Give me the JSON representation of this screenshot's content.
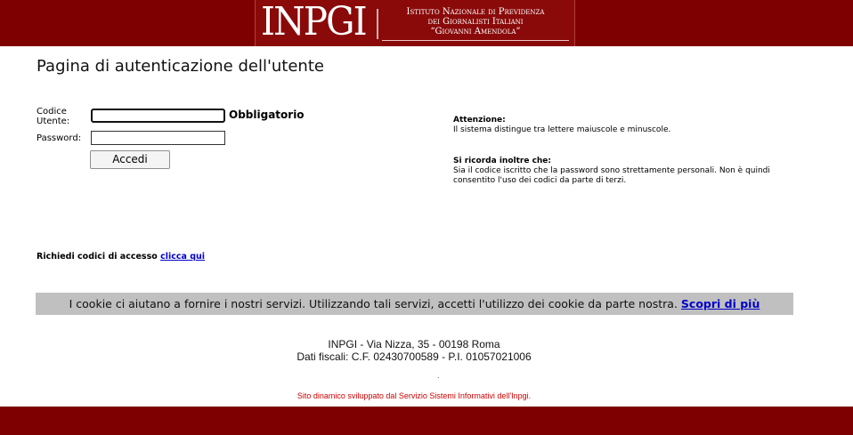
{
  "header": {
    "logo_word": "INPGI",
    "logo_line1": "Istituto Nazionale di Previdenza",
    "logo_line2": "dei Giornalisti Italiani",
    "logo_line3": "“Giovanni Amendola”"
  },
  "page": {
    "title": "Pagina di autenticazione dell'utente"
  },
  "form": {
    "user_label": "Codice Utente:",
    "user_value": "",
    "required_label": "Obbligatorio",
    "password_label": "Password:",
    "password_value": "",
    "submit_label": "Accedi"
  },
  "notices": {
    "attention_title": "Attenzione:",
    "attention_text": "Il sistema distingue tra lettere maiuscole e minuscole.",
    "reminder_title": "Si ricorda inoltre che:",
    "reminder_text": "Sia il codice iscritto che la password sono strettamente personali. Non è quindi consentito l'uso dei codici da parte di terzi."
  },
  "access": {
    "text": "Richiedi codici di accesso",
    "link_label": "clicca qui"
  },
  "cookie": {
    "text": "I cookie ci aiutano a fornire i nostri servizi. Utilizzando tali servizi, accetti l'utilizzo dei cookie da parte nostra.",
    "link_label": "Scopri di più"
  },
  "footer": {
    "address": "INPGI - Via Nizza, 35 - 00198 Roma",
    "fiscal": "Dati fiscali: C.F. 02430700589 - P.I. 01057021006",
    "dot": ".",
    "developer": "Sito dinamico sviluppato dal Servizio Sistemi Informativi dell'Inpgi."
  },
  "colors": {
    "brand_red": "#7f0000",
    "link_blue": "#0000cc",
    "cookie_bg": "#c0c0c0",
    "dev_text_red": "#cc0000"
  }
}
